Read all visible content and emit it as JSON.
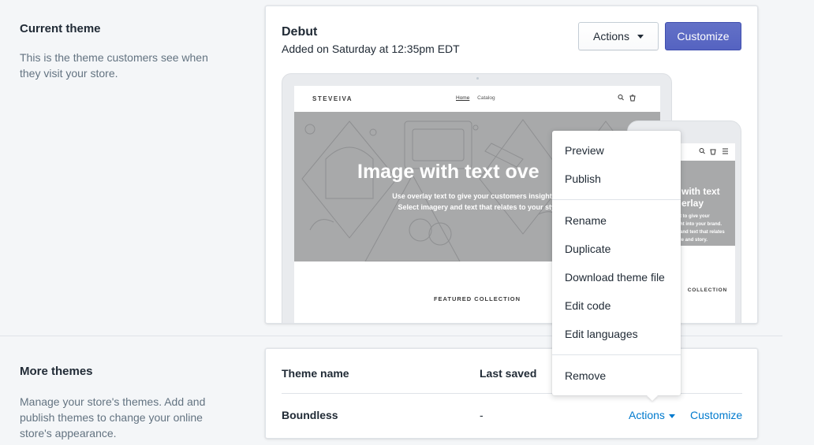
{
  "current_theme": {
    "title": "Current theme",
    "description": "This is the theme customers see when they visit your store.",
    "theme_name": "Debut",
    "added_text": "Added on Saturday at 12:35pm EDT",
    "actions_label": "Actions",
    "customize_label": "Customize",
    "preview": {
      "brand": "STEVEIVA",
      "nav": [
        "Home",
        "Catalog"
      ],
      "hero_title": "Image with text ove",
      "hero_sub_1": "Use overlay text to give your customers insight into",
      "hero_sub_2": "Select imagery and text that relates to your style",
      "featured": "FEATURED COLLECTION",
      "mobile_title_1": "with text",
      "mobile_title_2": "erlay",
      "mobile_sub_1": "t to give your",
      "mobile_sub_2": "ht into your brand.",
      "mobile_sub_3": "and text that relates",
      "mobile_sub_4": "le and story.",
      "mobile_featured": "COLLECTION"
    }
  },
  "actions_menu": {
    "items": [
      "Preview",
      "Publish",
      "Rename",
      "Duplicate",
      "Download theme file",
      "Edit code",
      "Edit languages",
      "Remove"
    ]
  },
  "more_themes": {
    "title": "More themes",
    "description": "Manage your store's themes. Add and publish themes to change your online store's appearance.",
    "columns": [
      "Theme name",
      "Last saved"
    ],
    "rows": [
      {
        "name": "Boundless",
        "last_saved": "-",
        "actions_label": "Actions",
        "customize_label": "Customize"
      }
    ]
  },
  "colors": {
    "primary": "#5c6ac4",
    "link": "#007ace",
    "text": "#212b36",
    "subdued": "#637381",
    "background": "#f4f6f8"
  }
}
